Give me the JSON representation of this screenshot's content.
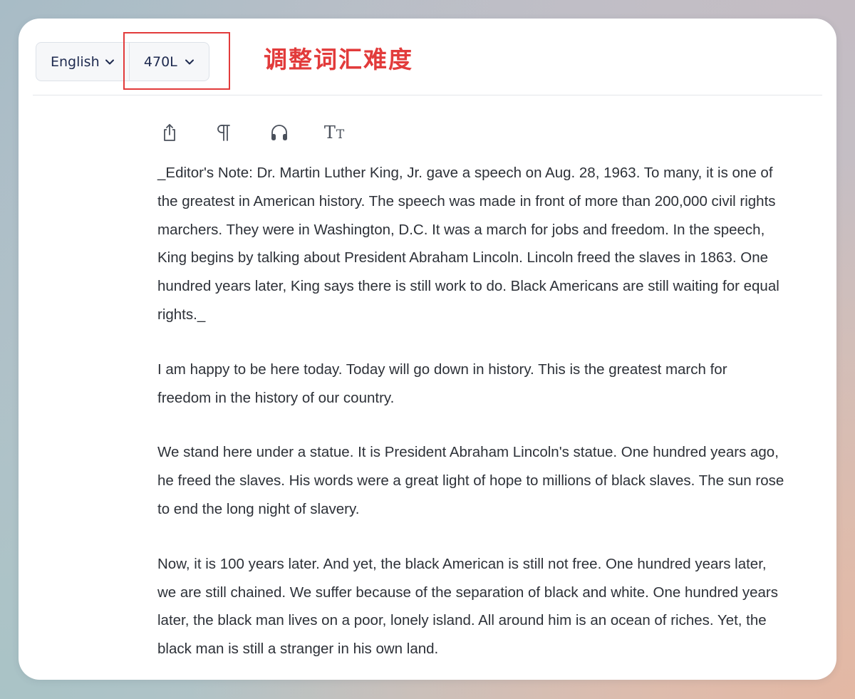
{
  "toolbar": {
    "language_label": "English",
    "level_label": "470L",
    "annotation_text": "调整词汇难度",
    "annotation_color": "#e23b3b"
  },
  "actions": [
    {
      "icon": "share-icon"
    },
    {
      "icon": "paragraph-icon"
    },
    {
      "icon": "headphones-icon"
    },
    {
      "icon": "text-size-icon",
      "glyph_big": "T",
      "glyph_small": "T"
    }
  ],
  "article": {
    "paragraphs": [
      "_Editor's Note: Dr. Martin Luther King, Jr. gave a speech on Aug. 28, 1963. To many, it is one of the greatest in American history. The speech was made in front of more than 200,000 civil rights marchers. They were in Washington, D.C. It was a march for jobs and freedom. In the speech, King begins by talking about President Abraham Lincoln. Lincoln freed the slaves in 1863. One hundred years later, King says there is still work to do. Black Americans are still waiting for equal rights._",
      "I am happy to be here today. Today will go down in history. This is the greatest march for freedom in the history of our country.",
      "We stand here under a statue. It is President Abraham Lincoln's statue. One hundred years ago, he freed the slaves. His words were a great light of hope to millions of black slaves. The sun rose to end the long night of slavery.",
      "Now, it is 100 years later. And yet, the black American is still not free. One hundred years later, we are still chained. We suffer because of the separation of black and white. One hundred years later, the black man lives on a poor, lonely island. All around him is an ocean of riches. Yet, the black man is still a stranger in his own land."
    ]
  }
}
